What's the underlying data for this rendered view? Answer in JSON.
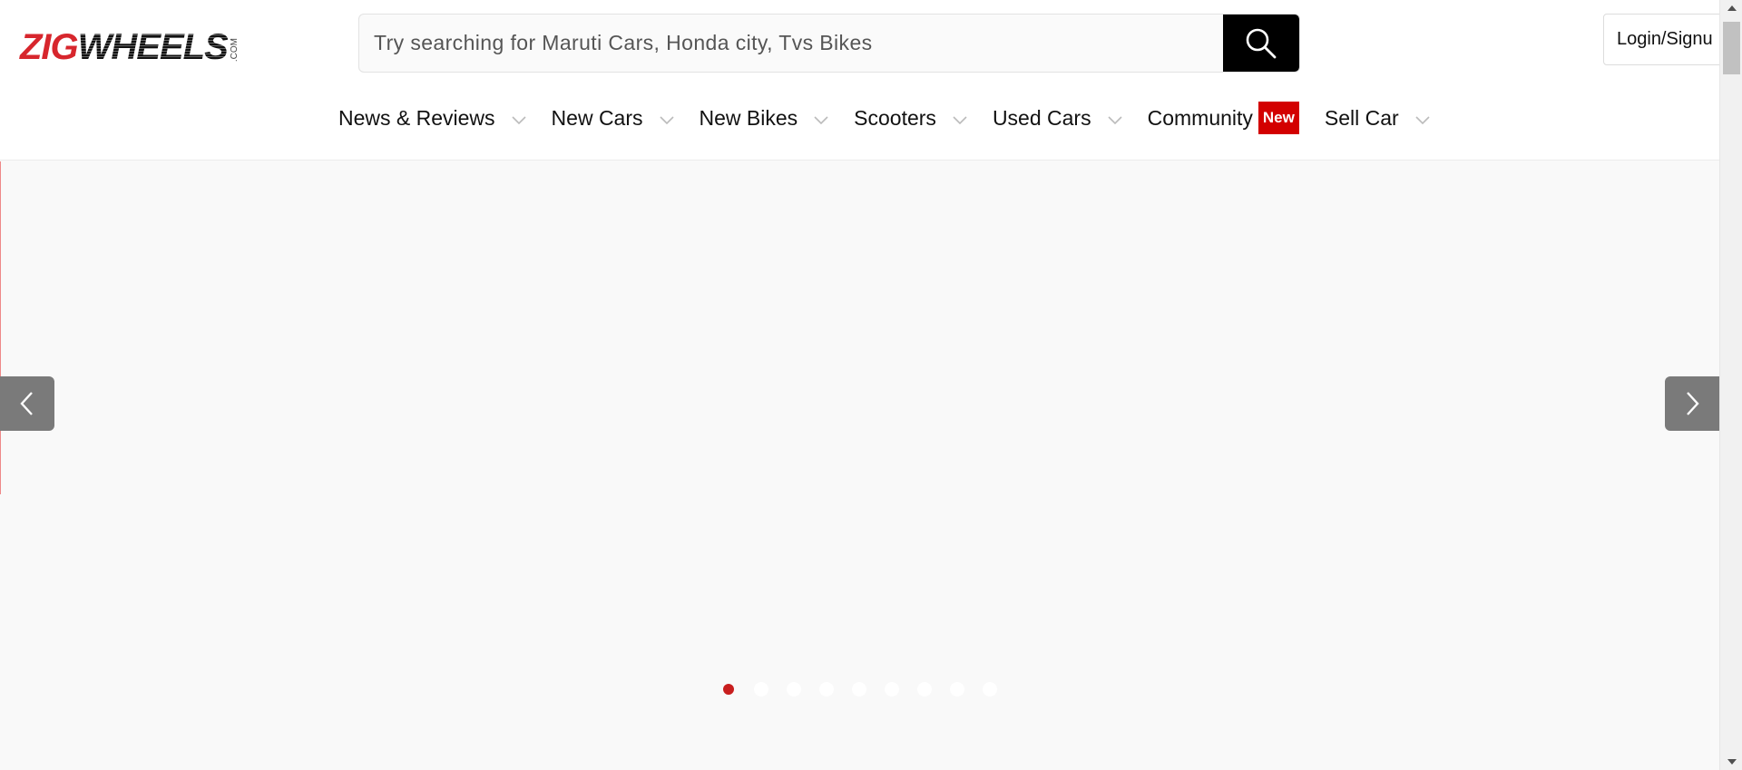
{
  "logo": {
    "zig": "ZIG",
    "wheels": "WHEELS",
    "com": ".COM"
  },
  "search": {
    "placeholder": "Try searching for Maruti Cars, Honda city, Tvs Bikes",
    "icon": "search-icon"
  },
  "header": {
    "login_label": "Login/Signu"
  },
  "nav": {
    "items": [
      {
        "label": "News & Reviews"
      },
      {
        "label": "New Cars"
      },
      {
        "label": "New Bikes"
      },
      {
        "label": "Scooters"
      },
      {
        "label": "Used Cars"
      },
      {
        "label": "Community",
        "badge": "New"
      },
      {
        "label": "Sell Car"
      }
    ]
  },
  "carousel": {
    "slide_count": 9,
    "active_index": 0
  },
  "colors": {
    "brand_red": "#d7262d",
    "badge_red": "#d30000",
    "active_dot": "#c81e1e",
    "arrow_bg": "#7a7a7a"
  }
}
